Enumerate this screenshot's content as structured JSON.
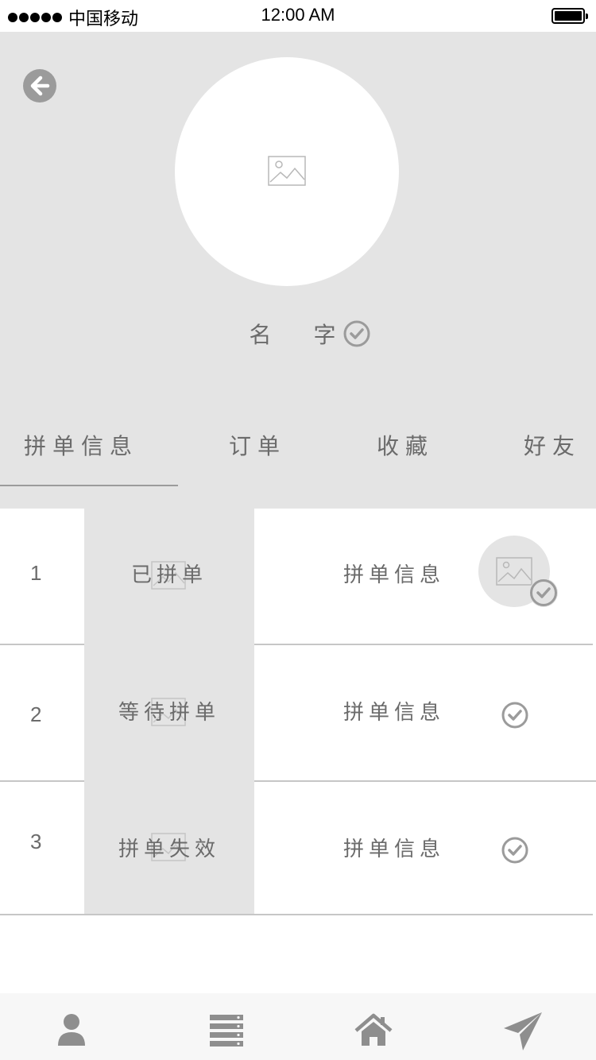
{
  "status_bar": {
    "carrier": "中国移动",
    "time": "12:00 AM"
  },
  "profile": {
    "name": "名 字",
    "back_icon": "back-arrow-icon",
    "verified_icon": "check-circle-icon"
  },
  "tabs": [
    {
      "label": "拼单信息",
      "active": true
    },
    {
      "label": "订单",
      "active": false
    },
    {
      "label": "收藏",
      "active": false
    },
    {
      "label": "好友",
      "active": false
    }
  ],
  "rows": [
    {
      "number": "1",
      "status": "已拼单",
      "info": "拼单信息",
      "has_thumbnail": true
    },
    {
      "number": "2",
      "status": "等待拼单",
      "info": "拼单信息",
      "has_thumbnail": false
    },
    {
      "number": "3",
      "status": "拼单失效",
      "info": "拼单信息",
      "has_thumbnail": false
    }
  ],
  "tab_bar": [
    {
      "icon": "user-icon"
    },
    {
      "icon": "list-icon"
    },
    {
      "icon": "home-icon"
    },
    {
      "icon": "send-icon"
    }
  ],
  "colors": {
    "header_bg": "#e4e4e4",
    "text": "#6b6b6b",
    "icon": "#9b9b9b",
    "tabbar_bg": "#f7f7f7"
  }
}
